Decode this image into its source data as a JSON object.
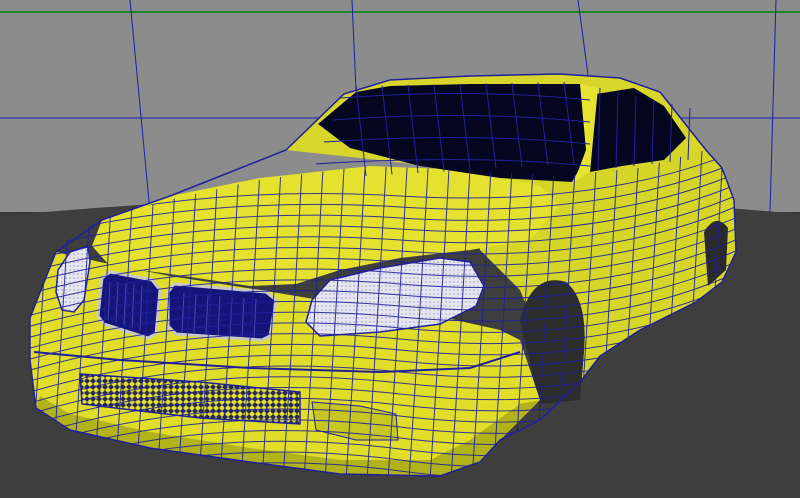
{
  "viewport": {
    "view": "perspective",
    "mode": "wireframe-on-shaded",
    "subject": "sedan-car-model"
  },
  "colors": {
    "background": "#8c8c8c",
    "floor": "#3e3e3e",
    "grid": "#1b1fb0",
    "horizon": "#1c8a2a",
    "body": "#e2e22a",
    "body_shadow": "#b2b21a",
    "body_light": "#f6f45a",
    "wire": "#20209a",
    "glass": "#050720",
    "headlight": "#dcdcec",
    "grille_mesh": "#2a2a5a",
    "kidney": "#14147a"
  },
  "icons": [
    "grid-lines",
    "wireframe-mesh"
  ]
}
